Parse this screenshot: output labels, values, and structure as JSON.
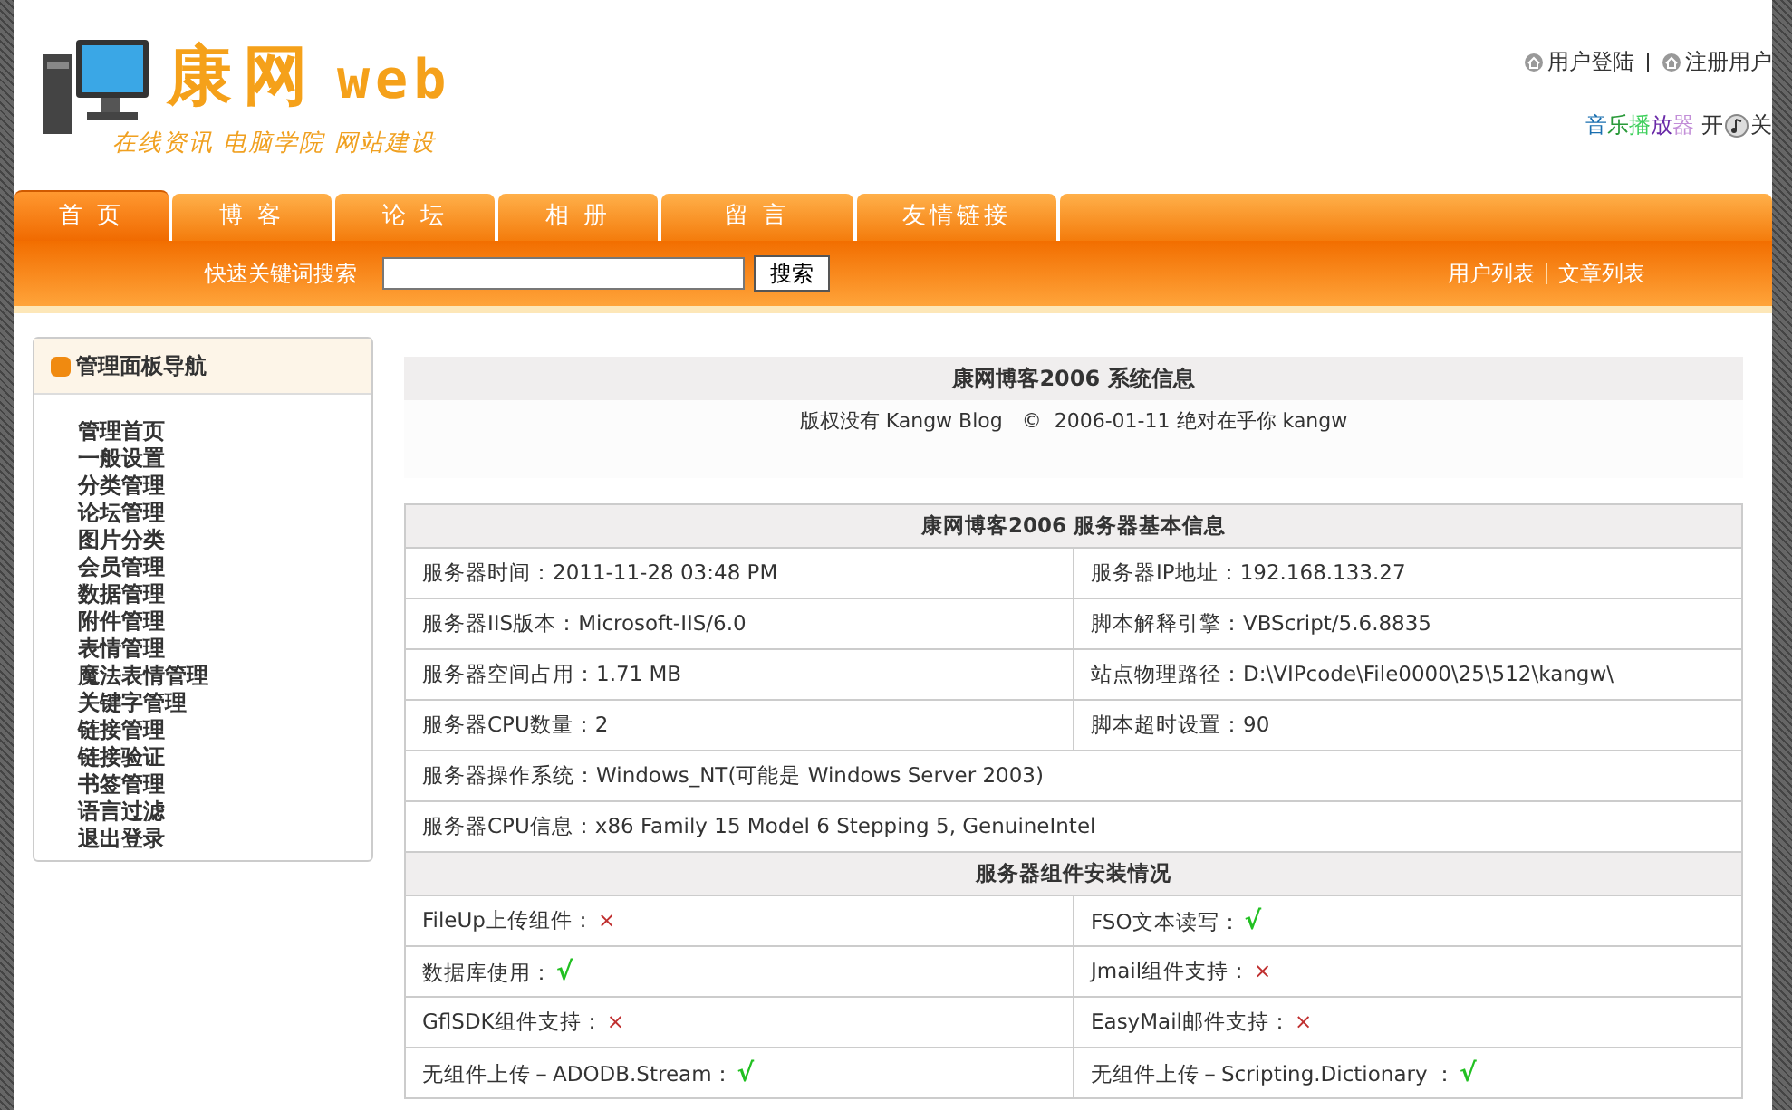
{
  "header": {
    "logo_title": "康网",
    "logo_web": "web",
    "slogan": "在线资讯 电脑学院 网站建设",
    "user_links": [
      "用户登陆",
      "注册用户"
    ],
    "music_label": "音乐播放器",
    "music_on": "开",
    "music_off": "关"
  },
  "tabs": [
    {
      "label": "首 页",
      "selected": true
    },
    {
      "label": "博 客",
      "selected": false
    },
    {
      "label": "论 坛",
      "selected": false
    },
    {
      "label": "相 册",
      "selected": false
    },
    {
      "label": "留 言",
      "selected": false
    },
    {
      "label": "友情链接",
      "selected": false
    }
  ],
  "search": {
    "label": "快速关键词搜索",
    "button": "搜索"
  },
  "quick_links": [
    "用户列表",
    "文章列表"
  ],
  "sidebar": {
    "title": "管理面板导航",
    "items": [
      "管理首页",
      "一般设置",
      "分类管理",
      "论坛管理",
      "图片分类",
      "会员管理",
      "数据管理",
      "附件管理",
      "表情管理",
      "魔法表情管理",
      "关键字管理",
      "链接管理",
      "链接验证",
      "书签管理",
      "语言过滤",
      "退出登录"
    ]
  },
  "system_info": {
    "title": "康网博客2006 系统信息",
    "copyright": "版权没有 Kangw Blog   ©  2006-01-11 绝对在乎你 kangw"
  },
  "server_info": {
    "title": "康网博客2006 服务器基本信息",
    "rows": [
      [
        "服务器时间：2011-11-28 03:48 PM",
        "服务器IP地址：192.168.133.27"
      ],
      [
        "服务器IIS版本：Microsoft-IIS/6.0",
        "脚本解释引擎：VBScript/5.6.8835"
      ],
      [
        "服务器空间占用：1.71 MB",
        "站点物理路径：D:\\VIPcode\\File0000\\25\\512\\kangw\\"
      ],
      [
        "服务器CPU数量：2",
        "脚本超时设置：90"
      ],
      [
        {
          "text": "服务器操作系统：Windows_NT(可能是 Windows Server 2003)",
          "colspan": 2
        }
      ],
      [
        {
          "text": "服务器CPU信息：x86 Family 15 Model 6 Stepping 5, GenuineIntel",
          "colspan": 2
        }
      ]
    ]
  },
  "components": {
    "title": "服务器组件安装情况",
    "items": [
      {
        "label": "FileUp上传组件：",
        "mark": "×",
        "supported": false
      },
      {
        "label": "FSO文本读写：",
        "mark": "√",
        "supported": true
      },
      {
        "label": "数据库使用：",
        "mark": "√",
        "supported": true
      },
      {
        "label": "Jmail组件支持：",
        "mark": "×",
        "supported": false
      },
      {
        "label": "GflSDK组件支持：",
        "mark": "×",
        "supported": false
      },
      {
        "label": "EasyMail邮件支持：",
        "mark": "×",
        "supported": false
      },
      {
        "label": "无组件上传－ADODB.Stream：",
        "mark": "√",
        "supported": true
      },
      {
        "label": "无组件上传－Scripting.Dictionary ：",
        "mark": "√",
        "supported": true
      }
    ]
  }
}
